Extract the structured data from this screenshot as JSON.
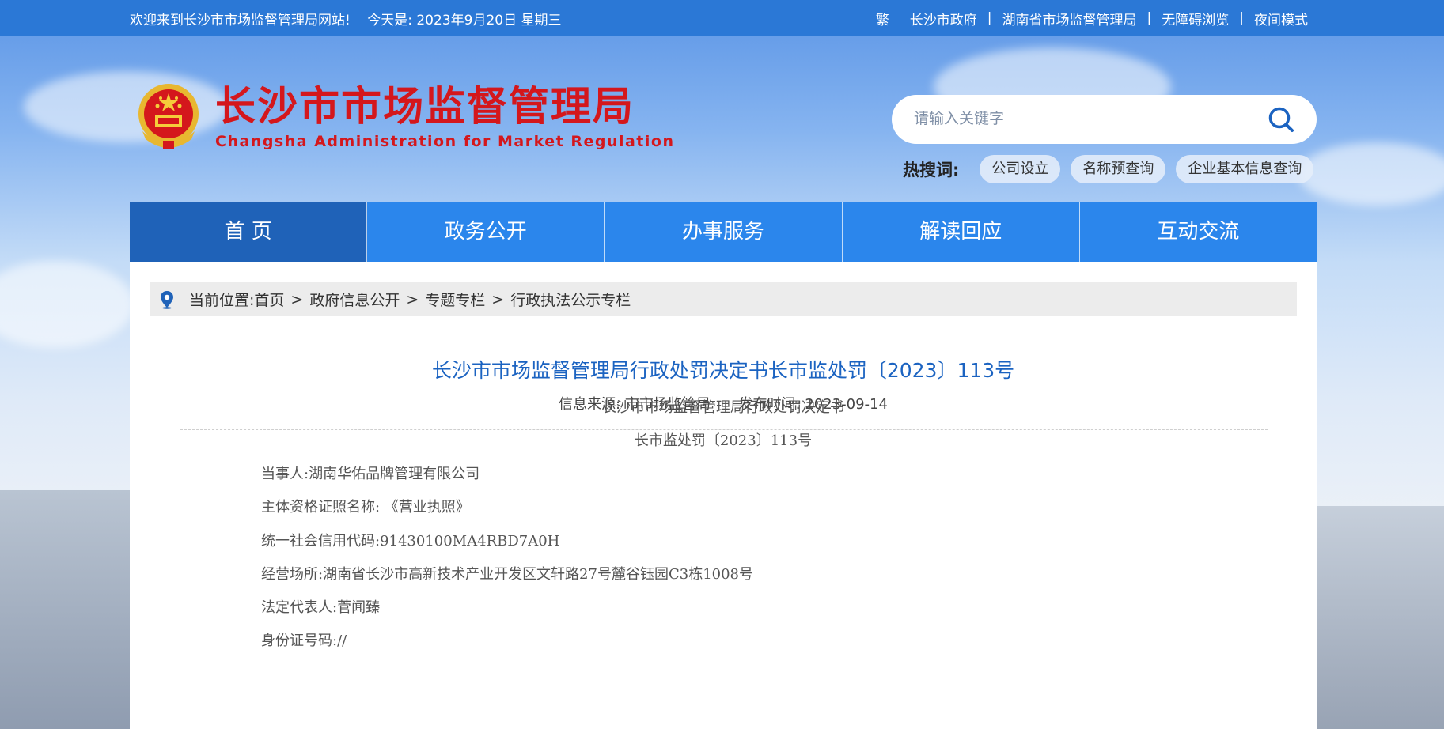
{
  "topbar": {
    "welcome": "欢迎来到长沙市市场监督管理局网站!",
    "date": "今天是:  2023年9月20日 星期三",
    "links": [
      "繁",
      "长沙市政府",
      "湖南省市场监督管理局",
      "无障碍浏览",
      "夜间模式"
    ],
    "separator": "|"
  },
  "logo": {
    "cn": "长沙市市场监督管理局",
    "en": "Changsha Administration for Market Regulation",
    "emblem_icon": "national-emblem-icon"
  },
  "search": {
    "placeholder": "请输入关键字",
    "icon": "search-icon"
  },
  "hot": {
    "label": "热搜词:",
    "tags": [
      "公司设立",
      "名称预查询",
      "企业基本信息查询"
    ]
  },
  "nav": {
    "items": [
      "首 页",
      "政务公开",
      "办事服务",
      "解读回应",
      "互动交流"
    ],
    "active": 0
  },
  "breadcrumb": {
    "label": "当前位置:",
    "items": [
      "首页",
      "政府信息公开",
      "专题专栏",
      "行政执法公示专栏"
    ],
    "arrow": ">"
  },
  "article": {
    "title": "长沙市市场监督管理局行政处罚决定书长市监处罚〔2023〕113号",
    "source": "信息来源:  市市场监管局",
    "published": "发布时间:  2023-09-14",
    "doc_title": "长沙市市场监督管理局行政处罚决定书",
    "doc_number": "长市监处罚〔2023〕113号",
    "lines": [
      "当事人:湖南华佑品牌管理有限公司",
      "主体资格证照名称: 《营业执照》",
      "统一社会信用代码:91430100MA4RBD7A0H",
      "经营场所:湖南省长沙市高新技术产业开发区文轩路27号麓谷钰园C3栋1008号",
      "法定代表人:菅闻臻",
      "身份证号码://"
    ]
  },
  "colors": {
    "topbar": "#2b78d6",
    "nav": "#2b86ec",
    "nav_active": "#1f62b8",
    "logo_red": "#d4171c",
    "title_blue": "#1b63c1"
  }
}
